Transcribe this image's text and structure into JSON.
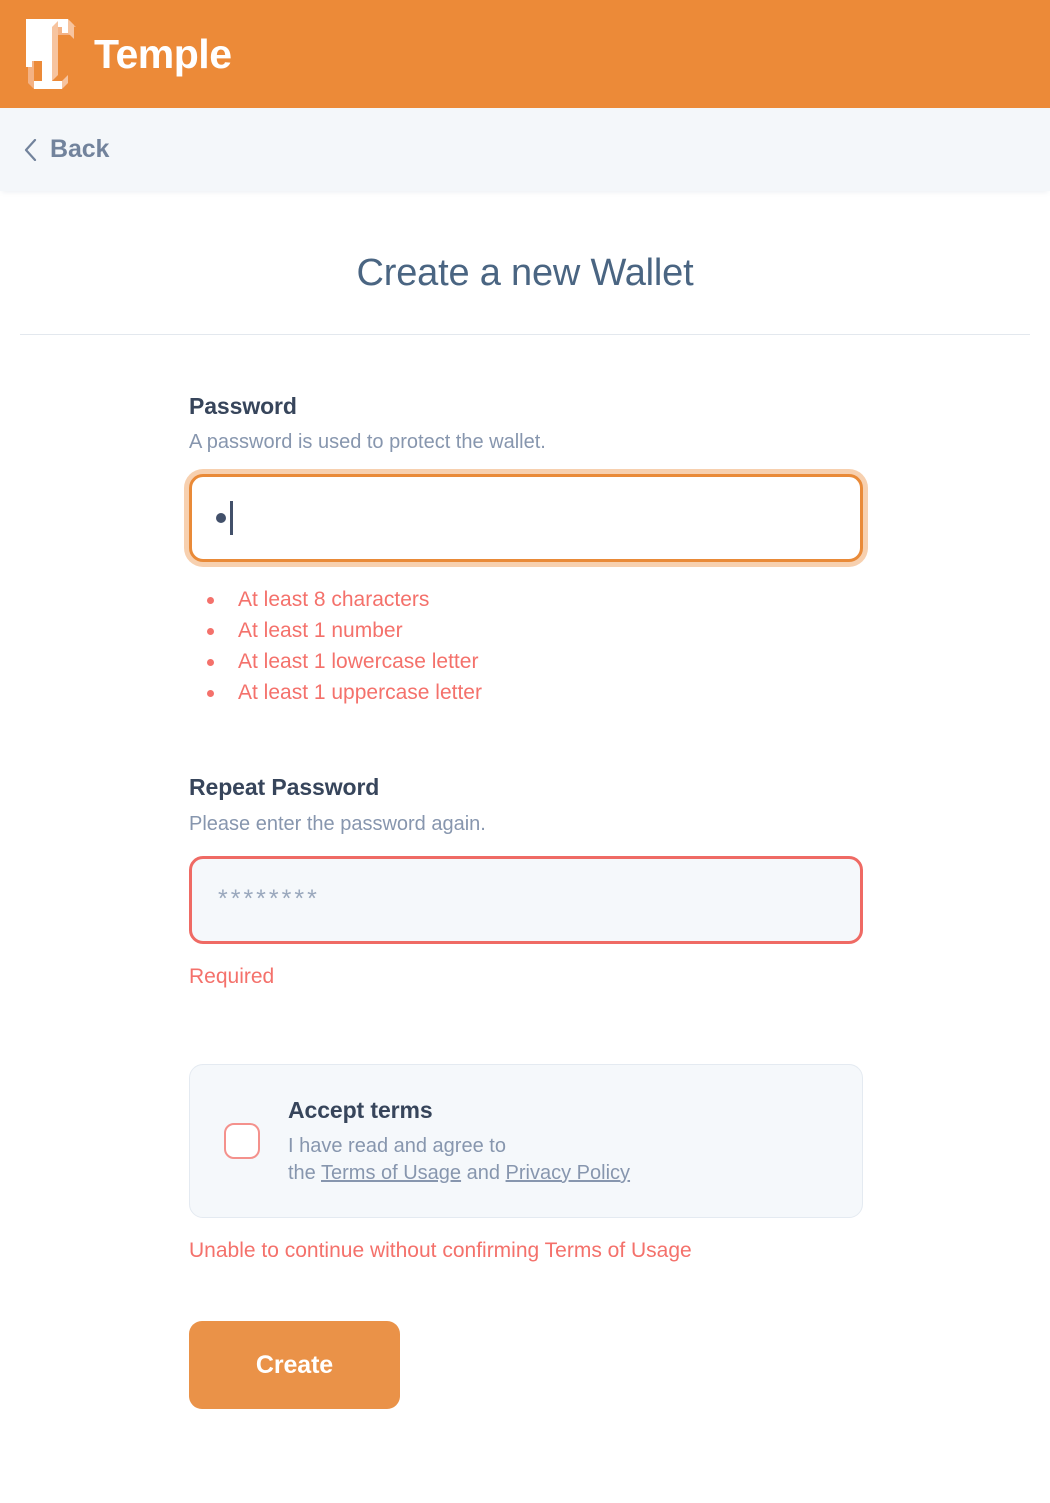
{
  "header": {
    "brand": "Temple",
    "logo_icon": "temple-t-logo-icon",
    "background_color": "#ec8a38"
  },
  "navbar": {
    "back_label": "Back",
    "back_icon": "chevron-left-icon",
    "background_color": "#f4f7fa"
  },
  "page": {
    "title": "Create a new Wallet"
  },
  "password": {
    "label": "Password",
    "hint": "A password is used to protect the wallet.",
    "value": "•",
    "placeholder": "",
    "masked_char_count": 1,
    "focused": true,
    "border_color": "#e98a38",
    "errors": [
      "At least 8 characters",
      "At least 1 number",
      "At least 1 lowercase letter",
      "At least 1 uppercase letter"
    ],
    "error_color": "#f4716b"
  },
  "repeat_password": {
    "label": "Repeat Password",
    "hint": "Please enter the password again.",
    "value": "",
    "placeholder": "********",
    "error": "Required",
    "border_color": "#ef6a64"
  },
  "terms": {
    "checkbox_checked": false,
    "checkbox_name": "accept-terms-checkbox",
    "title": "Accept terms",
    "body_line1": "I have read and agree to",
    "body_prefix": "the ",
    "link_terms": "Terms of Usage",
    "body_middle": " and ",
    "link_privacy": "Privacy Policy",
    "error": "Unable to continue without confirming Terms of Usage"
  },
  "actions": {
    "create_label": "Create",
    "create_color": "#ea9248"
  }
}
